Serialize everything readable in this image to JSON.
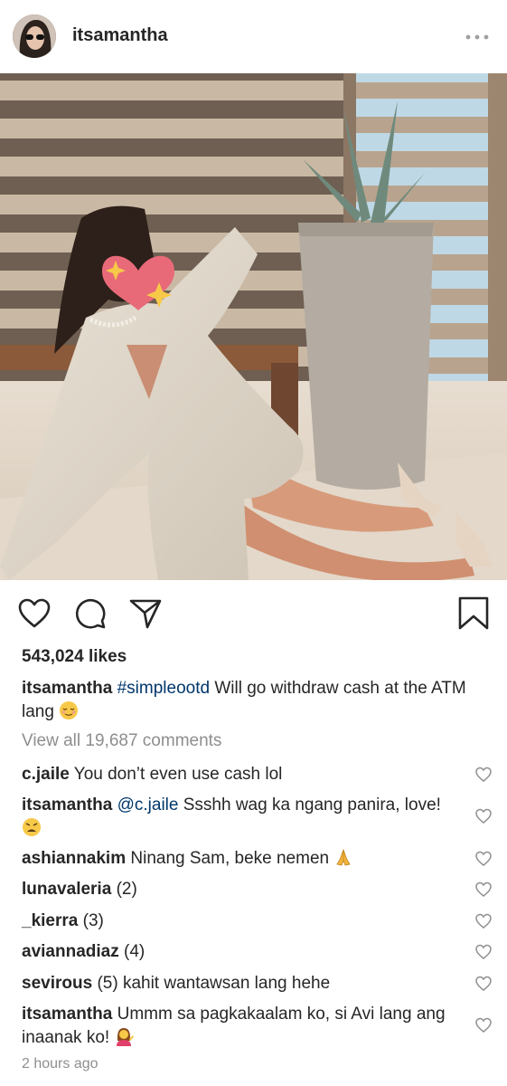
{
  "post": {
    "username": "itsamantha",
    "likes": "543,024 likes",
    "caption": {
      "username": "itsamantha",
      "hashtag": "#simpleootd",
      "text": "Will go withdraw cash at the ATM lang",
      "emoji": "relieved-face"
    },
    "view_all": "View all 19,687 comments",
    "time": "2 hours ago"
  },
  "comments": [
    {
      "username": "c.jaile",
      "text": "You don’t even use cash lol"
    },
    {
      "username": "itsamantha",
      "mention": "@c.jaile",
      "text": "Ssshh wag ka ngang panira, love!",
      "emoji": "weary-face"
    },
    {
      "username": "ashiannakim",
      "text": "Ninang Sam, beke nemen",
      "emoji": "folded-hands"
    },
    {
      "username": "lunavaleria",
      "text": "(2)"
    },
    {
      "username": "_kierra",
      "text": "(3)"
    },
    {
      "username": "aviannadiaz",
      "text": "(4)"
    },
    {
      "username": "sevirous",
      "text": "(5) kahit wantawsan lang hehe"
    },
    {
      "username": "itsamantha",
      "text": "Ummm sa pagkakaalam ko, si Avi lang ang inaanak ko!",
      "emoji": "person-tipping-hand"
    }
  ]
}
